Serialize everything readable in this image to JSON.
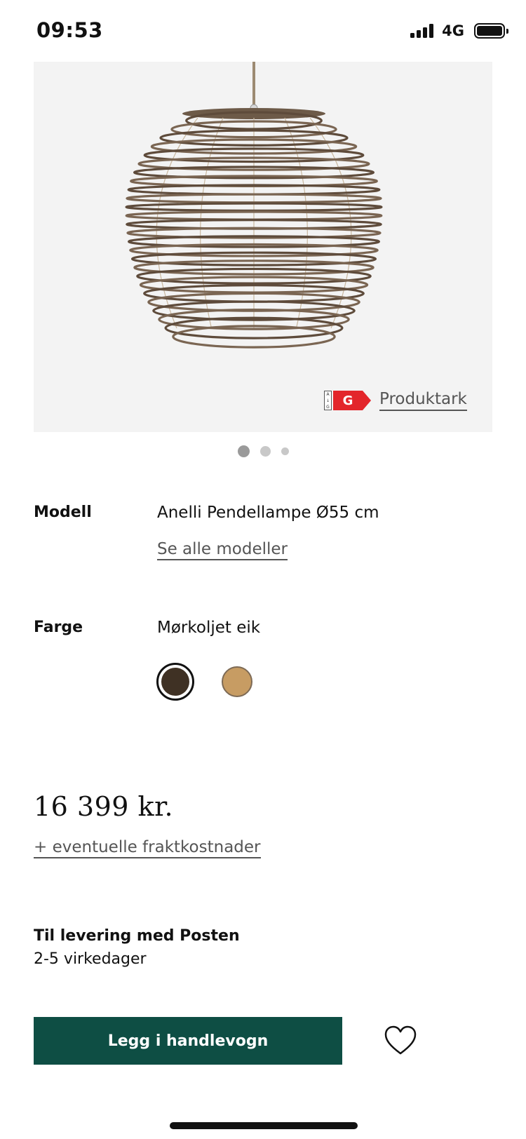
{
  "status": {
    "time": "09:53",
    "network": "4G"
  },
  "hero": {
    "energy_scale_top": "A",
    "energy_scale_bottom": "G",
    "energy_class": "G",
    "datasheet_link": "Produktark",
    "gallery_pages": 3,
    "gallery_active": 1
  },
  "product": {
    "model_label": "Modell",
    "model_value": "Anelli Pendellampe Ø55 cm",
    "all_models_link": "Se alle modeller",
    "color_label": "Farge",
    "color_value": "Mørkoljet eik",
    "swatches": [
      {
        "name": "Mørkoljet eik",
        "color": "#3f3124",
        "selected": true
      },
      {
        "name": "light-oak",
        "color": "#c79c63",
        "selected": false
      }
    ]
  },
  "price": {
    "amount": "16 399 kr.",
    "shipping_link": "+ eventuelle fraktkostnader"
  },
  "delivery": {
    "title": "Til levering med Posten",
    "time": "2-5 virkedager"
  },
  "actions": {
    "add_to_cart": "Legg i handlevogn",
    "wishlist_icon": "heart-icon"
  },
  "colors": {
    "brand_button": "#0e4e44",
    "energy_red": "#e3262b"
  }
}
